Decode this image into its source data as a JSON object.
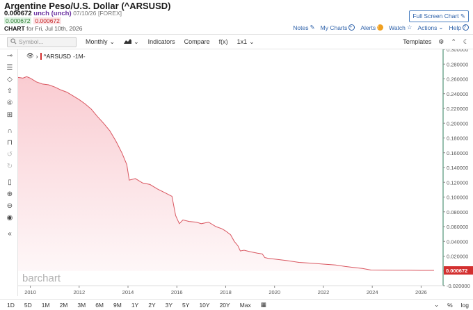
{
  "header": {
    "title": "Argentine Peso/U.S. Dollar (^ARSUSD)",
    "price": "0.000672",
    "change": "unch (unch)",
    "date": "07/10/26",
    "exchange": "[FOREX]",
    "bid": "0.000672",
    "ask": "0.000672",
    "chart_label": "CHART",
    "chart_for": "for Fri, Jul 10th, 2026"
  },
  "top_links": {
    "full_screen": "Full Screen Chart",
    "notes": "Notes",
    "my_charts": "My Charts",
    "alerts": "Alerts",
    "alerts_icon": "!",
    "watch": "Watch",
    "actions": "Actions",
    "help": "Help"
  },
  "toolbar": {
    "symbol_placeholder": "Symbol...",
    "period": "Monthly",
    "indicators": "Indicators",
    "compare": "Compare",
    "fx": "f(x)",
    "layout": "1x1",
    "templates": "Templates"
  },
  "legend": {
    "symbol": "^ARSUSD",
    "interval": "-1M-"
  },
  "watermark": "barchart",
  "bottom_ranges": [
    "1D",
    "5D",
    "1M",
    "2M",
    "3M",
    "6M",
    "9M",
    "1Y",
    "2Y",
    "3Y",
    "5Y",
    "10Y",
    "20Y",
    "Max"
  ],
  "bottom_right": {
    "percent": "%",
    "log": "log"
  },
  "colors": {
    "line": "#d9555f",
    "fill": "#f9c9cf",
    "last_price_bg": "#d32f2f",
    "link": "#2b5fa8"
  },
  "chart_data": {
    "type": "area",
    "title": "",
    "series": [
      {
        "name": "^ARSUSD",
        "points": [
          [
            2009.5,
            0.262
          ],
          [
            2009.7,
            0.261
          ],
          [
            2009.85,
            0.263
          ],
          [
            2010.0,
            0.261
          ],
          [
            2010.25,
            0.256
          ],
          [
            2010.5,
            0.253
          ],
          [
            2010.75,
            0.252
          ],
          [
            2011.0,
            0.249
          ],
          [
            2011.25,
            0.245
          ],
          [
            2011.5,
            0.242
          ],
          [
            2011.75,
            0.237
          ],
          [
            2012.0,
            0.232
          ],
          [
            2012.25,
            0.226
          ],
          [
            2012.5,
            0.219
          ],
          [
            2012.75,
            0.209
          ],
          [
            2013.0,
            0.2
          ],
          [
            2013.25,
            0.19
          ],
          [
            2013.5,
            0.176
          ],
          [
            2013.75,
            0.16
          ],
          [
            2013.95,
            0.144
          ],
          [
            2014.05,
            0.123
          ],
          [
            2014.3,
            0.125
          ],
          [
            2014.6,
            0.119
          ],
          [
            2014.9,
            0.117
          ],
          [
            2015.2,
            0.111
          ],
          [
            2015.5,
            0.106
          ],
          [
            2015.8,
            0.101
          ],
          [
            2015.95,
            0.075
          ],
          [
            2016.1,
            0.064
          ],
          [
            2016.25,
            0.069
          ],
          [
            2016.5,
            0.067
          ],
          [
            2016.8,
            0.066
          ],
          [
            2017.0,
            0.064
          ],
          [
            2017.3,
            0.066
          ],
          [
            2017.6,
            0.06
          ],
          [
            2017.85,
            0.057
          ],
          [
            2018.0,
            0.054
          ],
          [
            2018.2,
            0.049
          ],
          [
            2018.35,
            0.04
          ],
          [
            2018.5,
            0.034
          ],
          [
            2018.6,
            0.027
          ],
          [
            2018.75,
            0.028
          ],
          [
            2019.0,
            0.026
          ],
          [
            2019.3,
            0.024
          ],
          [
            2019.5,
            0.023
          ],
          [
            2019.6,
            0.018
          ],
          [
            2019.75,
            0.017
          ],
          [
            2020.0,
            0.016
          ],
          [
            2020.5,
            0.014
          ],
          [
            2021.0,
            0.0115
          ],
          [
            2021.5,
            0.0105
          ],
          [
            2022.0,
            0.0092
          ],
          [
            2022.5,
            0.008
          ],
          [
            2022.9,
            0.006
          ],
          [
            2023.3,
            0.0045
          ],
          [
            2023.6,
            0.0033
          ],
          [
            2023.95,
            0.0012
          ],
          [
            2024.5,
            0.00108
          ],
          [
            2025.0,
            0.00098
          ],
          [
            2025.5,
            0.00088
          ],
          [
            2026.0,
            0.00075
          ],
          [
            2026.53,
            0.000672
          ]
        ]
      }
    ],
    "xlim": [
      2009.5,
      2026.9
    ],
    "ylim": [
      -0.02,
      0.3
    ],
    "x_ticks": [
      "2010",
      "2012",
      "2014",
      "2016",
      "2018",
      "2020",
      "2022",
      "2024",
      "2026"
    ],
    "y_ticks": [
      "0.300000",
      "0.280000",
      "0.260000",
      "0.240000",
      "0.220000",
      "0.200000",
      "0.180000",
      "0.160000",
      "0.140000",
      "0.120000",
      "0.100000",
      "0.080000",
      "0.060000",
      "0.040000",
      "0.020000",
      "0.000000",
      "-0.020000"
    ],
    "last_price_label": "0.000672",
    "grid": false,
    "axis_position": "right"
  }
}
